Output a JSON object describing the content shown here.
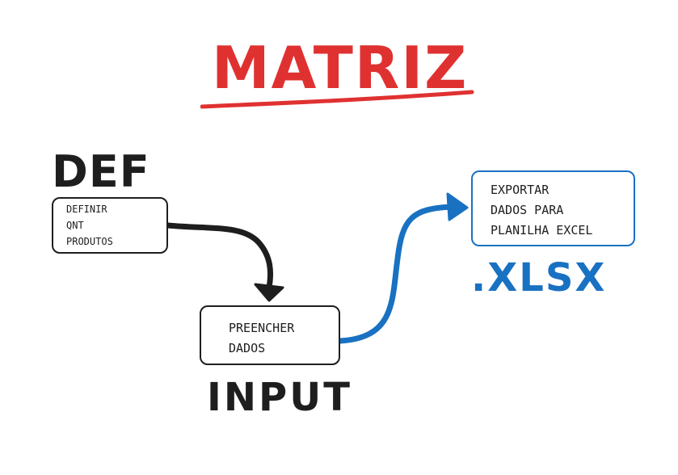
{
  "title": {
    "text": "MATRIZ",
    "color": "#e03131"
  },
  "nodes": {
    "def": {
      "label": "DEF",
      "lines": [
        "DEFINIR",
        "QNT",
        "PRODUTOS"
      ]
    },
    "input": {
      "label": "INPUT",
      "lines": [
        "PREENCHER",
        "DADOS"
      ]
    },
    "export": {
      "label": ".XLSX",
      "lines": [
        "EXPORTAR",
        "DADOS PARA",
        "PLANILHA EXCEL"
      ]
    }
  },
  "colors": {
    "stroke": "#1e1e1e",
    "title": "#e03131",
    "export_accent": "#1971c2"
  },
  "edges": [
    {
      "from": "def",
      "to": "input",
      "color": "#1e1e1e"
    },
    {
      "from": "input",
      "to": "export",
      "color": "#1971c2"
    }
  ]
}
